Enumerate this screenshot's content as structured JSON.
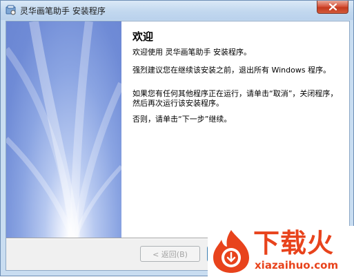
{
  "window": {
    "title": "灵华画笔助手 安装程序",
    "icon": "installer-icon",
    "close_icon": "close-icon"
  },
  "content": {
    "heading": "欢迎",
    "paragraphs": [
      "欢迎使用 灵华画笔助手  安装程序。",
      "强烈建议您在继续该安装之前，退出所有 Windows 程序。",
      "如果您有任何其他程序正在运行，请单击“取消”，关闭程序，然后再次运行该安装程序。",
      "否则，请单击“下一步”继续。"
    ]
  },
  "buttons": {
    "back_label": "< 返回(B)",
    "next_label": ""
  },
  "watermark": {
    "title": "下载火",
    "url": "xiazaihuo.com"
  },
  "colors": {
    "accent": "#e8431c",
    "sidebar": "#6f8bd6",
    "titlebar": "#c2d8ef"
  }
}
